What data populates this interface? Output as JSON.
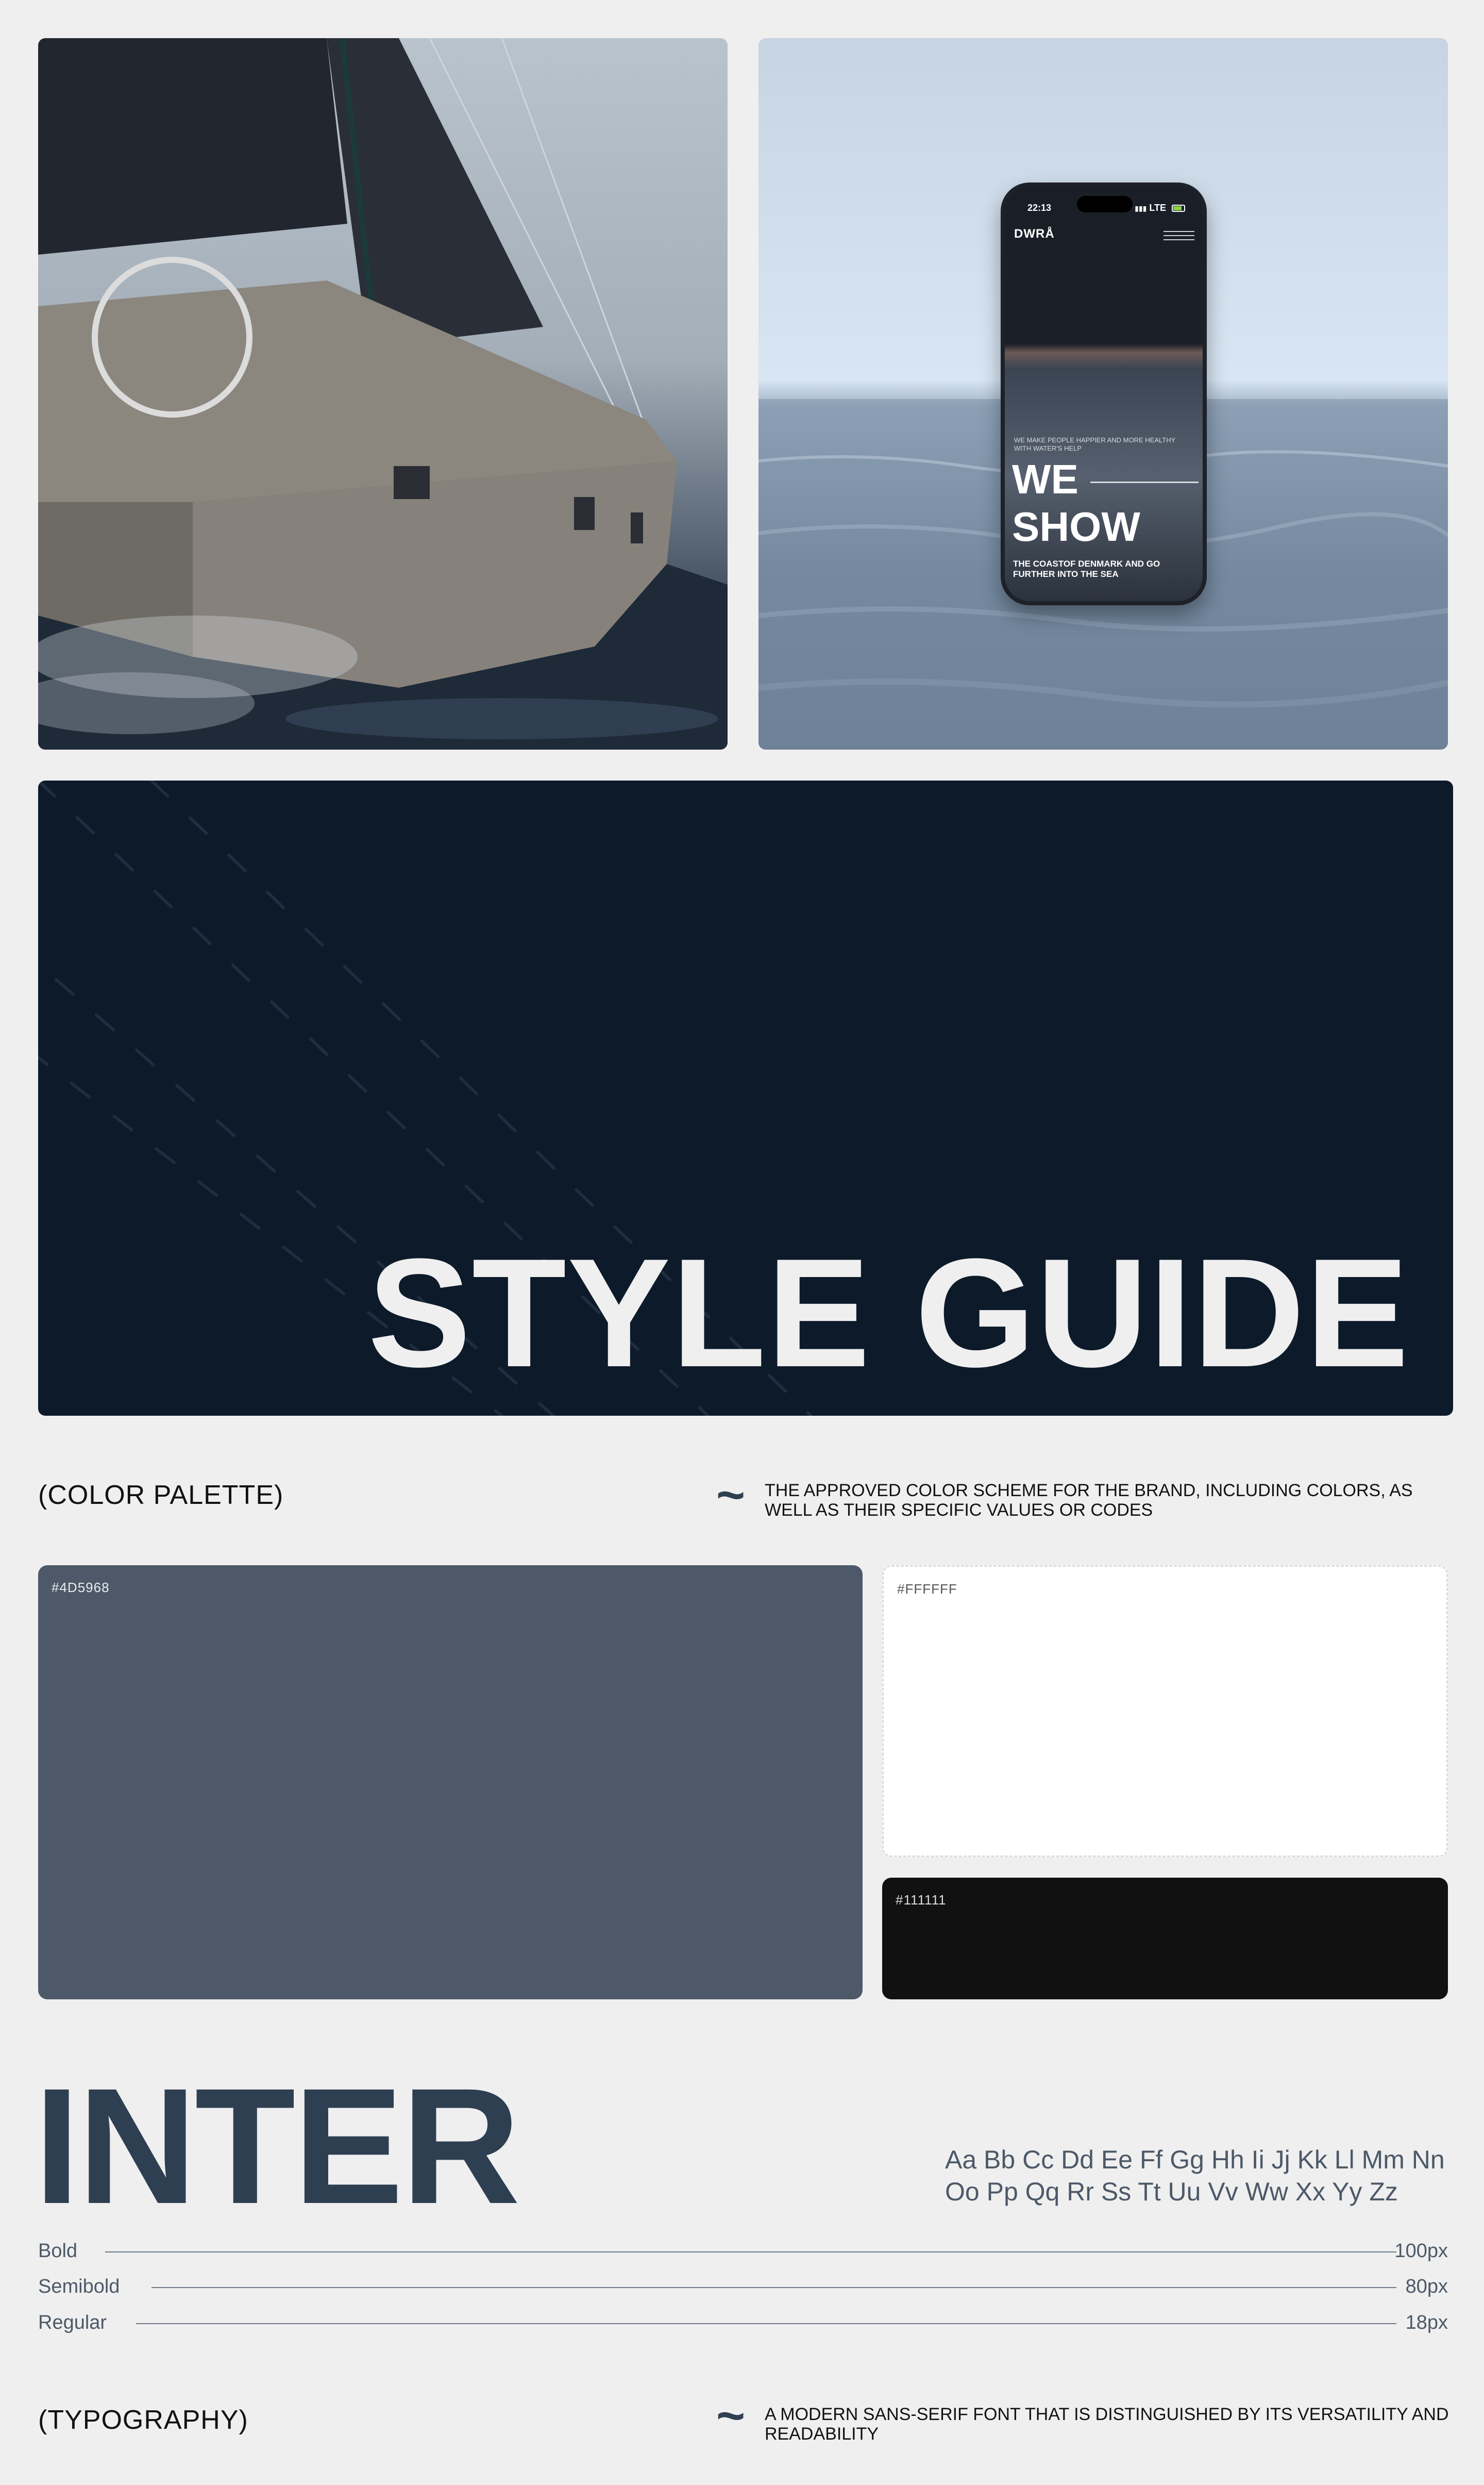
{
  "phone": {
    "time": "22:13",
    "network": "LTE",
    "logo": "DWRÅ",
    "tagline": "WE MAKE PEOPLE HAPPIER AND MORE HEALTHY WITH WATER'S HELP",
    "hero_line1": "WE",
    "hero_line2": "SHOW",
    "subtitle": "THE COASTOF DENMARK AND GO FURTHER INTO THE SEA"
  },
  "banner": {
    "title": "STYLE GUIDE"
  },
  "color_section": {
    "label": "(COLOR PALETTE)",
    "tilde": "~",
    "description": "THE APPROVED COLOR SCHEME FOR THE BRAND, INCLUDING  COLORS, AS WELL AS THEIR SPECIFIC VALUES OR CODES",
    "swatches": [
      {
        "code": "#4D5968",
        "color": "#4d5968"
      },
      {
        "code": "#FFFFFF",
        "color": "#ffffff"
      },
      {
        "code": "#111111",
        "color": "#111111"
      }
    ]
  },
  "typography": {
    "font_name": "INTER",
    "alphabet_line1": "Aa Bb Cc Dd Ee Ff Gg Hh Ii Jj Kk Ll Mm Nn",
    "alphabet_line2": "Oo Pp Qq Rr Ss Tt Uu Vv Ww Xx Yy Zz",
    "weights": [
      {
        "name": "Bold",
        "size": "100px"
      },
      {
        "name": "Semibold",
        "size": "80px"
      },
      {
        "name": "Regular",
        "size": "18px"
      }
    ],
    "label": "(TYPOGRAPHY)",
    "tilde": "~",
    "description": "A MODERN SANS-SERIF FONT THAT IS DISTINGUISHED BY ITS VERSATILITY AND READABILITY"
  },
  "colors": {
    "background": "#efefef",
    "navy": "#0d1a2a",
    "slate": "#2f3f52"
  }
}
